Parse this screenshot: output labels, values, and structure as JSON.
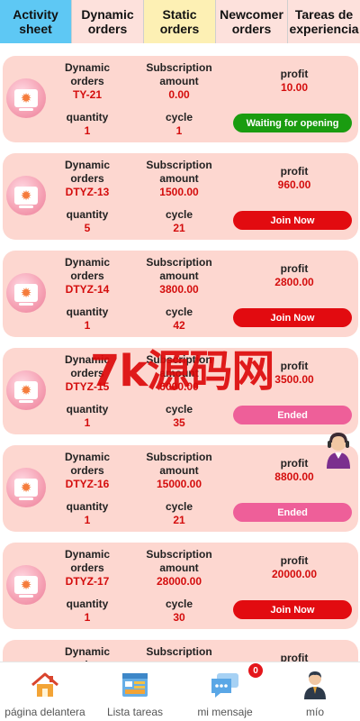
{
  "tabs": [
    {
      "label": "Activity sheet"
    },
    {
      "label": "Dynamic orders"
    },
    {
      "label": "Static orders"
    },
    {
      "label": "Newcomer orders"
    },
    {
      "label": "Tareas de experiencia"
    }
  ],
  "labels": {
    "name": "Dynamic orders",
    "amount": "Subscription amount",
    "quantity": "quantity",
    "cycle": "cycle",
    "profit": "profit"
  },
  "orders": [
    {
      "code": "TY-21",
      "amount": "0.00",
      "quantity": "1",
      "cycle": "1",
      "profit": "10.00",
      "status": "Waiting for opening",
      "status_type": "waiting"
    },
    {
      "code": "DTYZ-13",
      "amount": "1500.00",
      "quantity": "5",
      "cycle": "21",
      "profit": "960.00",
      "status": "Join Now",
      "status_type": "join"
    },
    {
      "code": "DTYZ-14",
      "amount": "3800.00",
      "quantity": "1",
      "cycle": "42",
      "profit": "2800.00",
      "status": "Join Now",
      "status_type": "join"
    },
    {
      "code": "DTYZ-15",
      "amount": "6000.00",
      "quantity": "1",
      "cycle": "35",
      "profit": "3500.00",
      "status": "Ended",
      "status_type": "ended"
    },
    {
      "code": "DTYZ-16",
      "amount": "15000.00",
      "quantity": "1",
      "cycle": "21",
      "profit": "8800.00",
      "status": "Ended",
      "status_type": "ended"
    },
    {
      "code": "DTYZ-17",
      "amount": "28000.00",
      "quantity": "1",
      "cycle": "30",
      "profit": "20000.00",
      "status": "Join Now",
      "status_type": "join"
    },
    {
      "code": "",
      "amount": "",
      "quantity": "",
      "cycle": "",
      "profit": "",
      "status": "",
      "status_type": "join"
    }
  ],
  "watermark": "7k源码网",
  "bottom_nav": [
    {
      "label": "página delantera",
      "icon": "home-icon"
    },
    {
      "label": "Lista tareas",
      "icon": "task-list-icon"
    },
    {
      "label": "mi mensaje",
      "icon": "message-icon",
      "badge": "0"
    },
    {
      "label": "mío",
      "icon": "profile-icon"
    }
  ],
  "colors": {
    "active_tab": "#5ec8f4",
    "card_bg": "#fdd7d0",
    "value_red": "#d40d0d",
    "waiting": "#1a9c10",
    "join": "#e20b10",
    "ended": "#ee5f99"
  }
}
